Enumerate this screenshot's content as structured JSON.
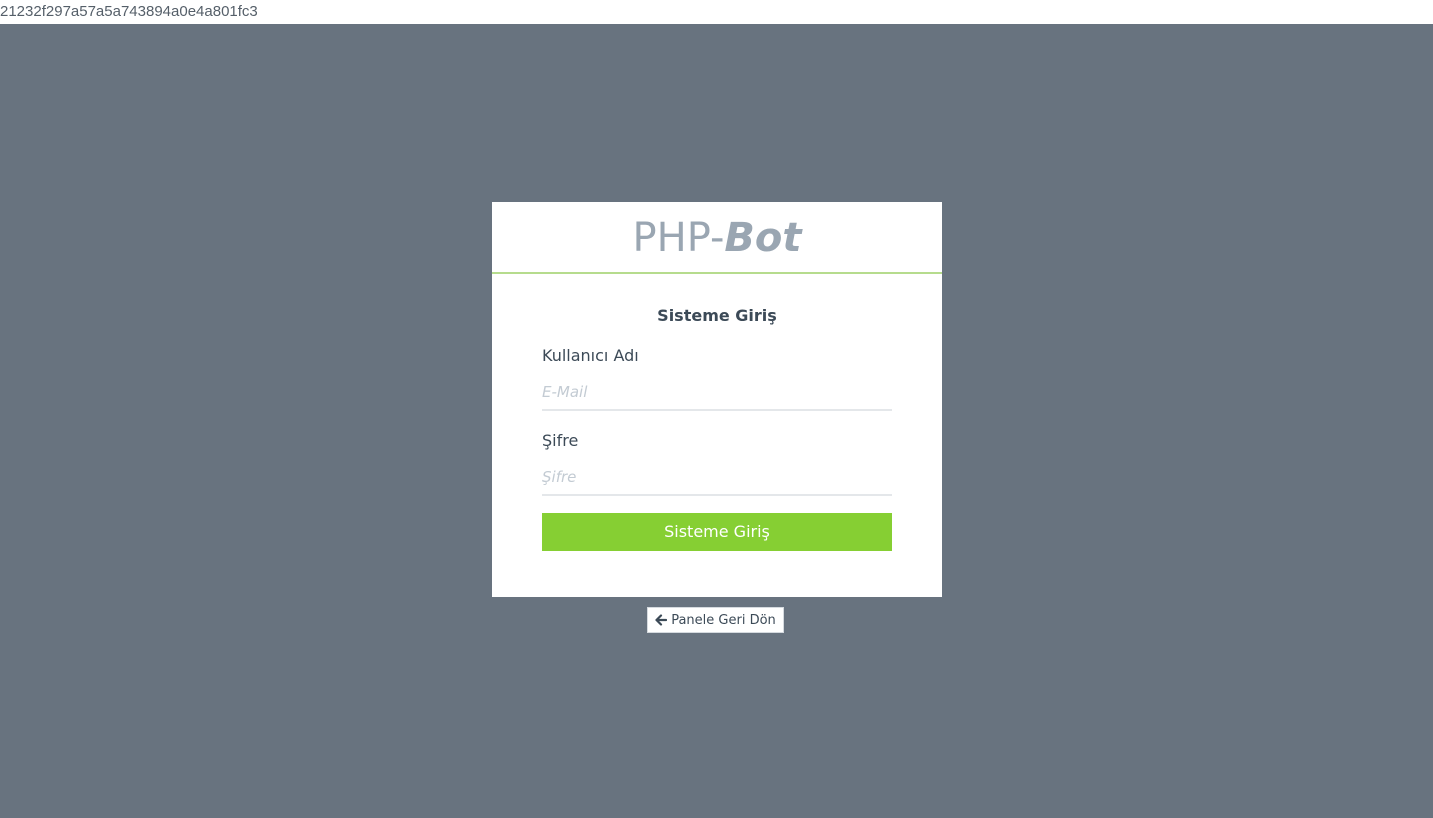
{
  "debug_hash": "21232f297a57a5a743894a0e4a801fc3",
  "colors": {
    "background": "#68737f",
    "accent": "#86cf33",
    "divider": "#b6dc8d"
  },
  "logo": {
    "prefix": "PHP-",
    "suffix": "Bot"
  },
  "login_form": {
    "title": "Sisteme Giriş",
    "username_label": "Kullanıcı Adı",
    "username_placeholder": "E-Mail",
    "username_value": "",
    "password_label": "Şifre",
    "password_placeholder": "Şifre",
    "password_value": "",
    "submit_label": "Sisteme Giriş"
  },
  "back_link": {
    "icon": "arrow-left-icon",
    "label": "Panele Geri Dön"
  }
}
